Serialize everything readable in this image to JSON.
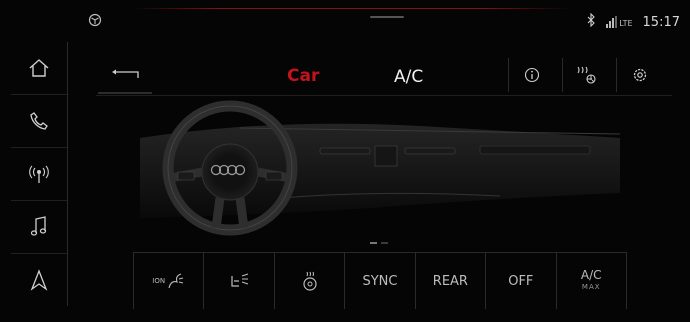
{
  "status_bar": {
    "clock": "15:17",
    "network_label": "LTE",
    "icons": [
      "settings-cube-icon",
      "bluetooth-icon",
      "signal-lte-icon"
    ]
  },
  "left_nav": {
    "items": [
      {
        "name": "home",
        "icon": "home-icon"
      },
      {
        "name": "phone",
        "icon": "phone-icon"
      },
      {
        "name": "radio",
        "icon": "radio-antenna-icon",
        "label": "((o))"
      },
      {
        "name": "media",
        "icon": "music-note-icon"
      },
      {
        "name": "navigation",
        "icon": "navigation-arrow-icon"
      }
    ]
  },
  "header": {
    "title_primary": "Car",
    "title_secondary": "A/C",
    "buttons": [
      "back-icon",
      "info-icon",
      "seat-heating-fan-icon",
      "settings-gear-icon"
    ]
  },
  "bottom_bar": {
    "buttons": [
      {
        "name": "ionizer",
        "label": "ION",
        "icon": "ionizer-icon"
      },
      {
        "name": "seat-ventilation",
        "icon": "seat-airflow-icon"
      },
      {
        "name": "steering-heat",
        "icon": "steering-wheel-heat-icon"
      },
      {
        "name": "sync",
        "label": "SYNC"
      },
      {
        "name": "rear",
        "label": "REAR"
      },
      {
        "name": "off",
        "label": "OFF"
      },
      {
        "name": "ac-max",
        "label": "A/C",
        "sublabel": "MAX"
      }
    ]
  },
  "colors": {
    "accent_red": "#c3131d",
    "background": "#050505",
    "text": "#cfcfcf"
  }
}
